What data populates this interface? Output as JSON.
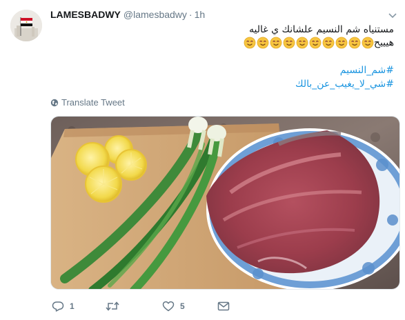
{
  "tweet": {
    "display_name": "LAMESBADWY",
    "handle": "@lamesbadwy",
    "separator": "·",
    "time": "1h",
    "text_line1": "مستنياه شم النسيم علشانك ي غاليه",
    "text_line2_word": "هيييح",
    "smiley_count": 10,
    "hashtags": [
      "#شم_النسيم",
      "#شي_لا_يغيب_عن_بالك"
    ],
    "translate_label": "Translate Tweet"
  },
  "actions": {
    "reply_count": "1",
    "retweet_count": "",
    "like_count": "5"
  },
  "colors": {
    "link": "#1b95e0",
    "muted": "#657786",
    "text": "#14171a",
    "emoji": "#f7c53f"
  },
  "icons": [
    "avatar-flag",
    "chevron-down-icon",
    "globe-icon",
    "reply-icon",
    "retweet-icon",
    "heart-icon",
    "envelope-icon"
  ],
  "media": {
    "description_alt": ""
  }
}
